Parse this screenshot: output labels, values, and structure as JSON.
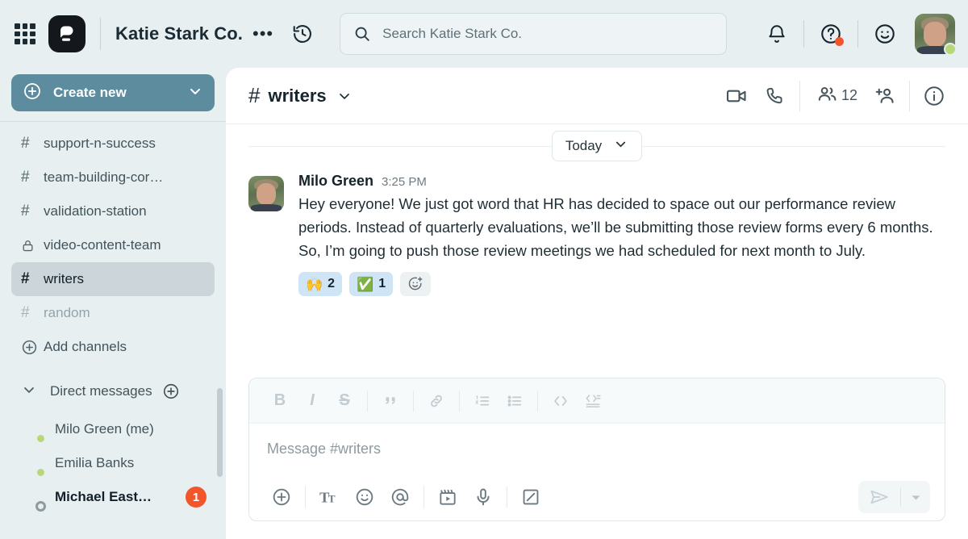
{
  "topbar": {
    "apps_grid_icon": "apps-grid-icon",
    "logo_icon": "pumble-logo-icon",
    "workspace_title": "Katie Stark Co.",
    "more_label": "•••",
    "history_icon": "history-icon",
    "search": {
      "placeholder": "Search Katie Stark Co.",
      "value": "",
      "icon": "search-icon"
    },
    "notifications_icon": "bell-icon",
    "help_icon": "help-icon",
    "help_has_badge": true,
    "status_icon": "smiley-icon",
    "avatar": "user-avatar",
    "presence": "online"
  },
  "sidebar": {
    "create_new": {
      "label": "Create new",
      "icon": "plus-circle-icon",
      "chevron": "chevron-down-icon"
    },
    "channels": [
      {
        "name": "support-n-success",
        "icon": "hash-icon",
        "state": "normal"
      },
      {
        "name": "team-building-cor…",
        "icon": "hash-icon",
        "state": "normal"
      },
      {
        "name": "validation-station",
        "icon": "hash-icon",
        "state": "normal"
      },
      {
        "name": "video-content-team",
        "icon": "lock-icon",
        "state": "normal"
      },
      {
        "name": "writers",
        "icon": "hash-icon",
        "state": "active"
      },
      {
        "name": "random",
        "icon": "hash-icon",
        "state": "muted"
      }
    ],
    "add_channels": {
      "label": "Add channels",
      "icon": "plus-circle-icon"
    },
    "direct_messages": {
      "label": "Direct messages",
      "chevron": "chevron-down-icon",
      "add_icon": "plus-circle-icon",
      "people": [
        {
          "name": "Milo Green (me)",
          "presence": "online",
          "unread": "",
          "avatar": "milo-avatar"
        },
        {
          "name": "Emilia Banks",
          "presence": "online",
          "unread": "",
          "avatar": "emilia-avatar"
        },
        {
          "name": "Michael East…",
          "presence": "away",
          "unread": "1",
          "avatar": "michael-avatar"
        }
      ]
    }
  },
  "channel_header": {
    "hash": "#",
    "name": "writers",
    "chevron": "chevron-down-icon",
    "video_icon": "video-camera-icon",
    "call_icon": "phone-icon",
    "members_icon": "members-icon",
    "members_count": "12",
    "add_member_icon": "add-person-icon",
    "info_icon": "info-icon"
  },
  "messages": {
    "day_divider": {
      "label": "Today",
      "chevron": "chevron-down-icon"
    },
    "items": [
      {
        "author": "Milo Green",
        "time": "3:25 PM",
        "avatar": "milo-avatar",
        "text": "Hey everyone! We just got word that HR has decided to space out our performance review periods. Instead of quarterly evaluations, we’ll be submitting those review forms every 6 months. So, I’m going to push those review meetings we had scheduled for next month to July.",
        "reactions": [
          {
            "emoji": "🙌",
            "count": "2",
            "selected": true
          },
          {
            "emoji": "✅",
            "count": "1",
            "selected": true
          }
        ],
        "add_reaction_icon": "add-reaction-icon"
      }
    ]
  },
  "composer": {
    "placeholder": "Message #writers",
    "value": "",
    "format_tools": [
      {
        "name": "bold-button",
        "glyph": "B"
      },
      {
        "name": "italic-button",
        "glyph": "I"
      },
      {
        "name": "strikethrough-button",
        "glyph": "S"
      },
      {
        "name": "blockquote-button",
        "glyph": "”"
      },
      {
        "name": "link-button",
        "glyph": "link-icon"
      },
      {
        "name": "ordered-list-button",
        "glyph": "ordered-list-icon"
      },
      {
        "name": "bulleted-list-button",
        "glyph": "bulleted-list-icon"
      },
      {
        "name": "code-button",
        "glyph": "code-icon"
      },
      {
        "name": "code-block-button",
        "glyph": "code-block-icon"
      }
    ],
    "action_tools": [
      {
        "name": "attach-button",
        "glyph": "plus-circle-icon"
      },
      {
        "name": "text-format-button",
        "glyph": "text-format-icon"
      },
      {
        "name": "emoji-button",
        "glyph": "smiley-icon"
      },
      {
        "name": "mention-button",
        "glyph": "at-icon"
      },
      {
        "name": "video-clip-button",
        "glyph": "video-clip-icon"
      },
      {
        "name": "audio-clip-button",
        "glyph": "microphone-icon"
      },
      {
        "name": "canvas-button",
        "glyph": "canvas-icon"
      }
    ],
    "send": {
      "icon": "send-icon",
      "chevron": "chevron-down-icon"
    }
  },
  "colors": {
    "sidebar_bg": "#e7eff1",
    "accent_button": "#5d8c9e",
    "badge": "#f2552c",
    "presence_online": "#b7d77a",
    "reaction_selected": "#cfe5f5"
  }
}
